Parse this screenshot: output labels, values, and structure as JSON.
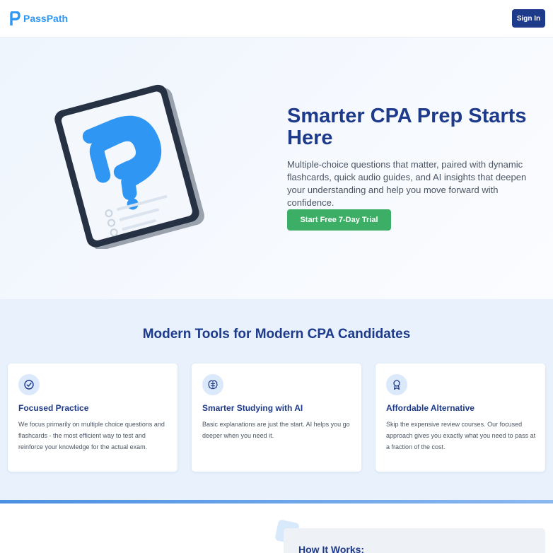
{
  "nav": {
    "brand_name": "PassPath",
    "sign_in_label": "Sign In"
  },
  "hero": {
    "title": "Smarter CPA Prep Starts Here",
    "subtitle": "Multiple-choice questions that matter, paired with dynamic flashcards, quick audio guides, and AI insights that deepen your understanding and help you move forward with confidence.",
    "cta_label": "Start Free 7-Day Trial",
    "illustration_icon": "tablet-question-mark-icon"
  },
  "features": {
    "title": "Modern Tools for Modern CPA Candidates",
    "cards": [
      {
        "icon": "check-circle-icon",
        "title": "Focused Practice",
        "text": "We focus primarily on multiple choice questions and flashcards - the most efficient way to test and reinforce your knowledge for the actual exam."
      },
      {
        "icon": "brain-icon",
        "title": "Smarter Studying with AI",
        "text": "Basic explanations are just the start. AI helps you go deeper when you need it."
      },
      {
        "icon": "award-icon",
        "title": "Affordable Alternative",
        "text": "Skip the expensive review courses. Our focused approach gives you exactly what you need to pass at a fraction of the cost."
      }
    ]
  },
  "how_it_works": {
    "title": "How It Works:"
  },
  "colors": {
    "brand_blue": "#2f97f3",
    "navy": "#1e3a8a",
    "cta_green": "#3dae65"
  }
}
